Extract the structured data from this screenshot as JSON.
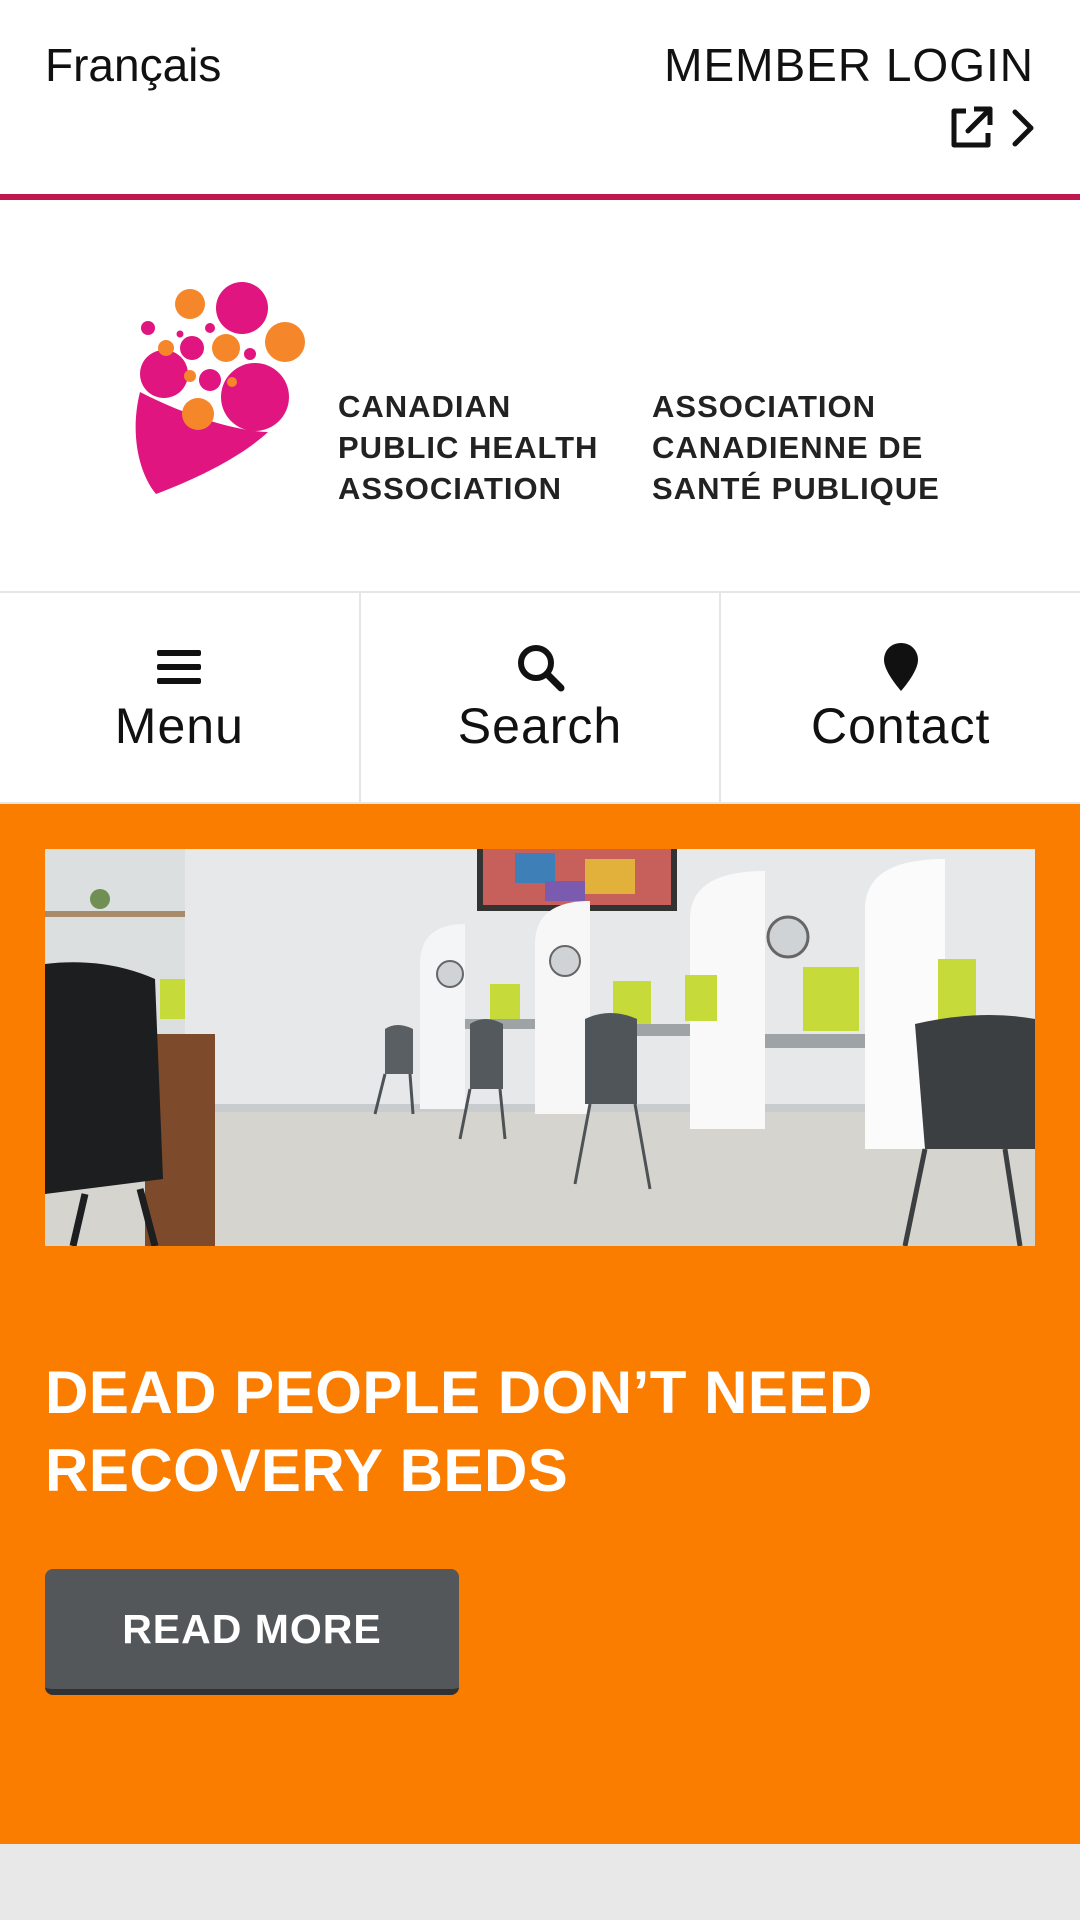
{
  "header": {
    "language_link": "Français",
    "member_login": "MEMBER LOGIN",
    "icons": [
      "external-link-icon",
      "chevron-right-icon"
    ],
    "accent_color": "#c0174f"
  },
  "logo": {
    "name_en": [
      "CANADIAN",
      "PUBLIC HEALTH",
      "ASSOCIATION"
    ],
    "name_fr": [
      "ASSOCIATION",
      "CANADIENNE DE",
      "SANTÉ PUBLIQUE"
    ],
    "colors": {
      "magenta": "#e0157f",
      "orange": "#f5862a"
    }
  },
  "nav": [
    {
      "label": "Menu",
      "icon": "hamburger-menu-icon"
    },
    {
      "label": "Search",
      "icon": "search-icon"
    },
    {
      "label": "Contact",
      "icon": "map-pin-icon"
    }
  ],
  "hero": {
    "background_color": "#fa7d00",
    "image_alt": "supervised consumption site booths with chairs",
    "title_lines": [
      "DEAD PEOPLE DON’T NEED",
      "RECOVERY BEDS"
    ],
    "button_label": "READ MORE"
  }
}
